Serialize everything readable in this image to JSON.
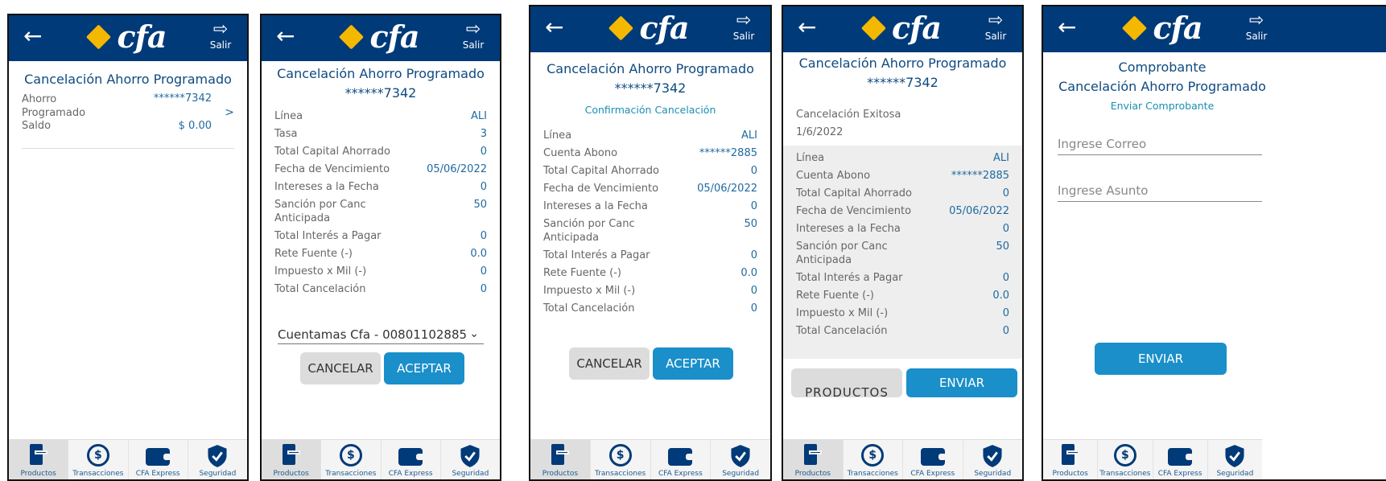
{
  "header": {
    "logo_text": "cfa",
    "exit_label": "Salir",
    "back_glyph": "←",
    "exit_glyph": "⇨"
  },
  "tabs": [
    {
      "label": "Productos",
      "icon": "products-icon"
    },
    {
      "label": "Transacciones",
      "icon": "transactions-icon"
    },
    {
      "label": "CFA Express",
      "icon": "wallet-icon"
    },
    {
      "label": "Seguridad",
      "icon": "shield-icon"
    }
  ],
  "screen1": {
    "title": "Cancelación Ahorro Programado",
    "product_label": "Ahorro Programado",
    "account": "******7342",
    "chevron": ">",
    "balance_label": "Saldo",
    "balance": "$ 0.00"
  },
  "screen2": {
    "title": "Cancelación Ahorro Programado",
    "account": "******7342",
    "rows": [
      {
        "label": "Línea",
        "value": "ALI"
      },
      {
        "label": "Tasa",
        "value": "3"
      },
      {
        "label": "Total Capital Ahorrado",
        "value": "0"
      },
      {
        "label": "Fecha de Vencimiento",
        "value": "05/06/2022"
      },
      {
        "label": "Intereses a la Fecha",
        "value": "0"
      },
      {
        "label": "Sanción por Canc Anticipada",
        "value": "50"
      },
      {
        "label": "Total Interés a Pagar",
        "value": "0"
      },
      {
        "label": "Rete Fuente (-)",
        "value": "0.0"
      },
      {
        "label": "Impuesto x Mil (-)",
        "value": "0"
      },
      {
        "label": "Total Cancelación",
        "value": "0"
      }
    ],
    "select_value": "Cuentamas Cfa - 00801102885",
    "cancel_label": "CANCELAR",
    "accept_label": "ACEPTAR"
  },
  "screen3": {
    "title": "Cancelación Ahorro Programado",
    "account": "******7342",
    "subtitle": "Confirmación Cancelación",
    "rows": [
      {
        "label": "Línea",
        "value": "ALI"
      },
      {
        "label": "Cuenta Abono",
        "value": "******2885"
      },
      {
        "label": "Total Capital Ahorrado",
        "value": "0"
      },
      {
        "label": "Fecha de Vencimiento",
        "value": "05/06/2022"
      },
      {
        "label": "Intereses a la Fecha",
        "value": "0"
      },
      {
        "label": "Sanción por Canc Anticipada",
        "value": "50"
      },
      {
        "label": "Total Interés a Pagar",
        "value": "0"
      },
      {
        "label": "Rete Fuente (-)",
        "value": "0.0"
      },
      {
        "label": "Impuesto x Mil (-)",
        "value": "0"
      },
      {
        "label": "Total Cancelación",
        "value": "0"
      }
    ],
    "cancel_label": "CANCELAR",
    "accept_label": "ACEPTAR"
  },
  "screen4": {
    "title": "Cancelación Ahorro Programado",
    "account": "******7342",
    "status": "Cancelación Exitosa",
    "date": "1/6/2022",
    "rows": [
      {
        "label": "Línea",
        "value": "ALI"
      },
      {
        "label": "Cuenta Abono",
        "value": "******2885"
      },
      {
        "label": "Total Capital Ahorrado",
        "value": "0"
      },
      {
        "label": "Fecha de Vencimiento",
        "value": "05/06/2022"
      },
      {
        "label": "Intereses a la Fecha",
        "value": "0"
      },
      {
        "label": "Sanción por Canc Anticipada",
        "value": "50"
      },
      {
        "label": "Total Interés a Pagar",
        "value": "0"
      },
      {
        "label": "Rete Fuente (-)",
        "value": "0.0"
      },
      {
        "label": "Impuesto x Mil (-)",
        "value": "0"
      },
      {
        "label": "Total Cancelación",
        "value": "0"
      }
    ],
    "products_label": "PRODUCTOS",
    "send_label": "ENVIAR"
  },
  "screen5": {
    "title1": "Comprobante",
    "title2": "Cancelación Ahorro Programado",
    "subtitle": "Enviar Comprobante",
    "email_placeholder": "Ingrese Correo",
    "subject_placeholder": "Ingrese Asunto",
    "send_label": "ENVIAR"
  }
}
